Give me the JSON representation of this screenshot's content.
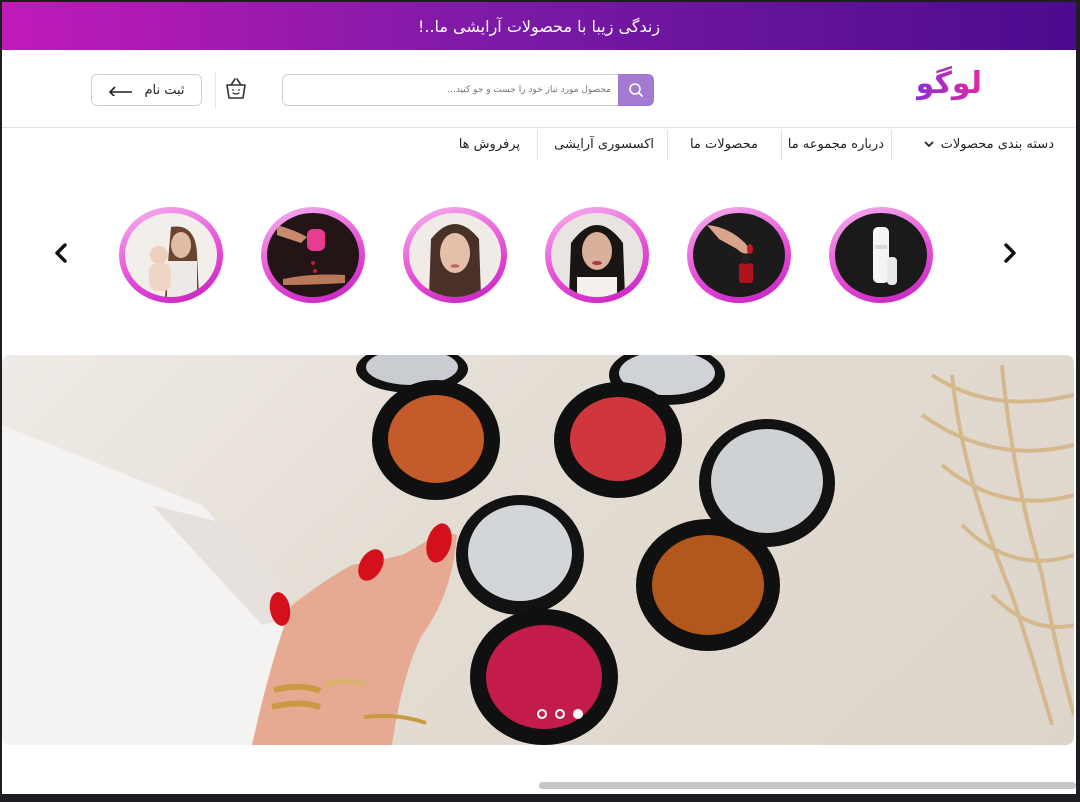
{
  "promo": {
    "text": "زندگی زیبا با محصولات آرایشی ما..!"
  },
  "header": {
    "logo": "لوگو",
    "search": {
      "placeholder": "محصول مورد نیاز خود را جست و جو کنید..."
    },
    "register_label": "ثبت نام"
  },
  "nav": {
    "items": [
      {
        "label": "دسته بندی محصولات",
        "has_dropdown": true
      },
      {
        "label": "درباره مجموعه ما"
      },
      {
        "label": "محصولات ما"
      },
      {
        "label": "اکسسوری آرایشی"
      },
      {
        "label": "پرفروش ها"
      }
    ]
  },
  "stories": {
    "items": [
      {
        "subject": "white-device"
      },
      {
        "subject": "hand-red-nail-polish"
      },
      {
        "subject": "woman-lipstick"
      },
      {
        "subject": "woman-face"
      },
      {
        "subject": "hands-pink-bottle"
      },
      {
        "subject": "mother-baby"
      }
    ]
  },
  "banner": {
    "subject": "blush-compacts-hand-red-nails",
    "dots_count": 3,
    "active_dot": 3
  },
  "colors": {
    "promo_start": "#c11ab8",
    "promo_end": "#4b0b8f",
    "accent_purple": "#a479d2",
    "story_ring": "#e64fd6"
  }
}
